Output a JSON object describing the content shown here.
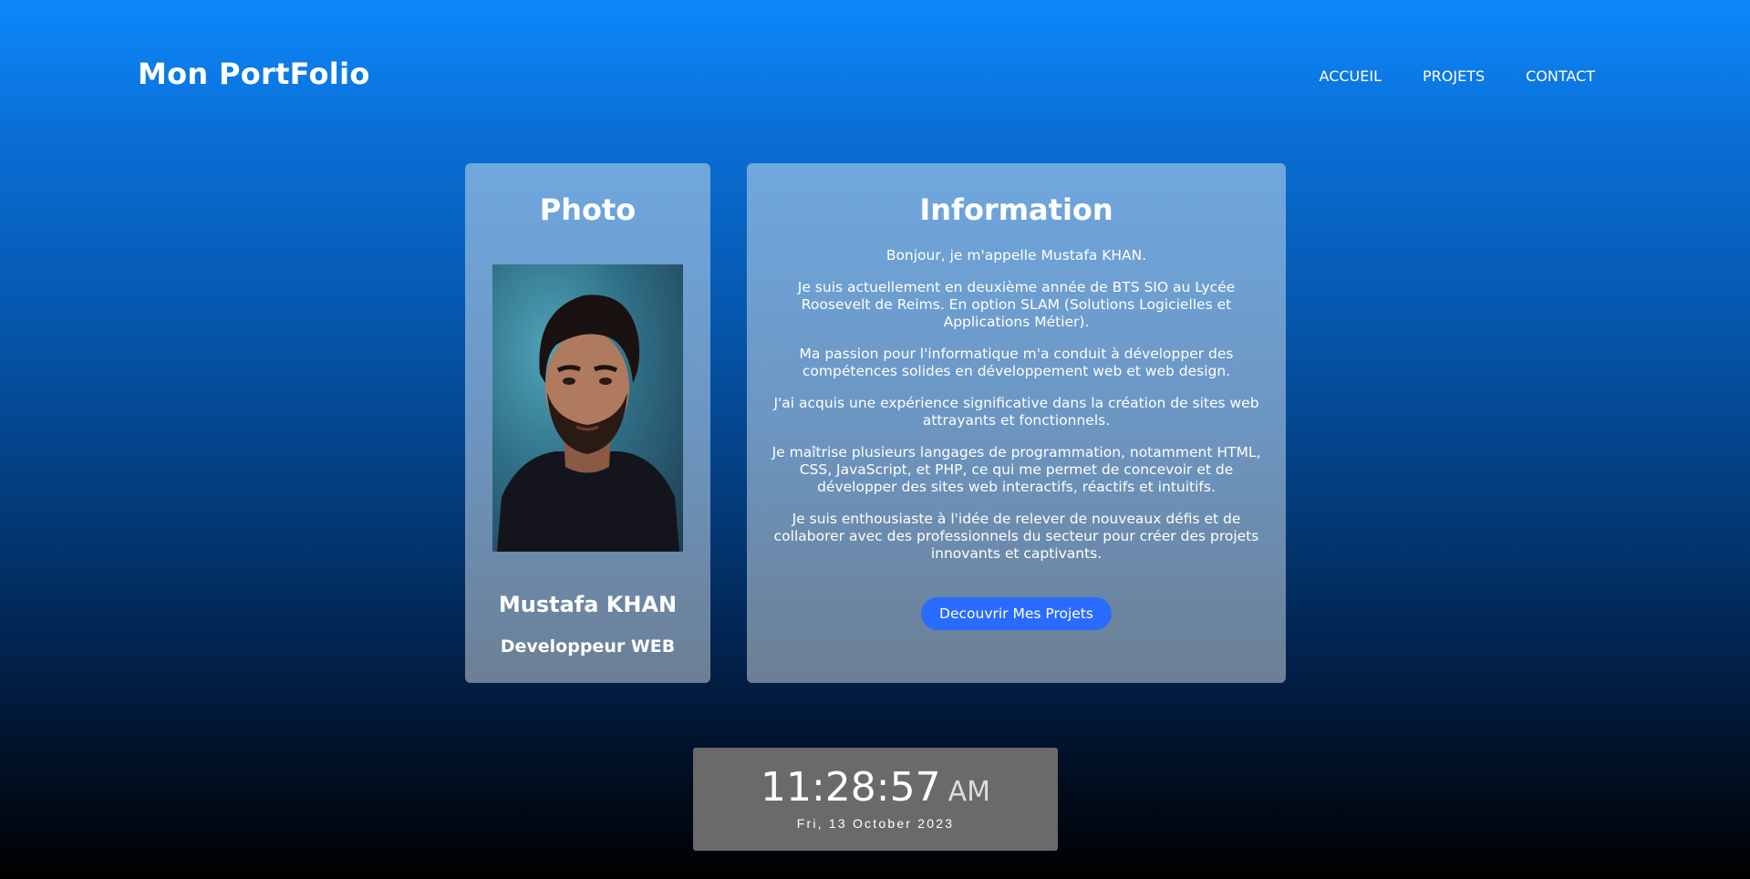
{
  "brand": "Mon PortFolio",
  "nav": [
    "ACCUEIL",
    "PROJETS",
    "CONTACT"
  ],
  "photo_card": {
    "title": "Photo",
    "name": "Mustafa KHAN",
    "role": "Developpeur WEB"
  },
  "info_card": {
    "title": "Information",
    "paragraphs": [
      "Bonjour, je m'appelle Mustafa KHAN.",
      "Je suis actuellement en deuxième année de BTS SIO au Lycée Roosevelt de Reims. En option SLAM (Solutions Logicielles et Applications Métier).",
      "Ma passion pour l'informatique m'a conduit à développer des compétences solides en développement web et web design.",
      "J'ai acquis une expérience significative dans la création de sites web attrayants et fonctionnels.",
      "Je maîtrise plusieurs langages de programmation, notamment HTML, CSS, JavaScript, et PHP, ce qui me permet de concevoir et de développer des sites web interactifs, réactifs et intuitifs.",
      "Je suis enthousiaste à l'idée de relever de nouveaux défis et de collaborer avec des professionnels du secteur pour créer des projets innovants et captivants."
    ],
    "button": "Decouvrir Mes Projets"
  },
  "clock": {
    "time": "11:28:57",
    "ampm": "AM",
    "date": "Fri, 13 October 2023"
  },
  "colors": {
    "button": "#2a6bff",
    "clock_bg": "#6a6a6a"
  }
}
